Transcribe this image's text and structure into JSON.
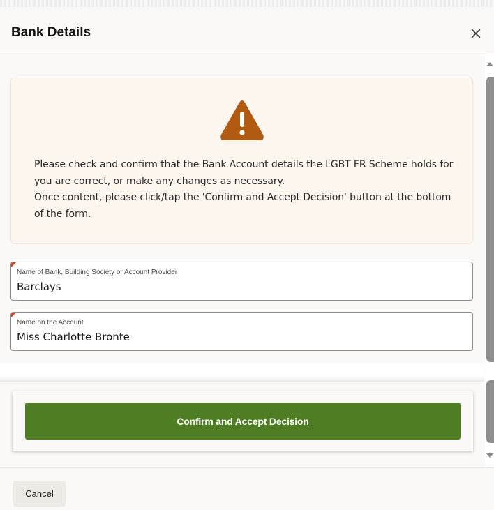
{
  "dialog": {
    "title": "Bank Details",
    "close_icon": "close-icon"
  },
  "warning": {
    "icon": "warning-triangle-icon",
    "icon_color": "#b05a12",
    "line1": "Please check and confirm that the Bank Account details the LGBT FR Scheme holds for you are correct, or make any changes as necessary.",
    "line2": "Once content, please click/tap the 'Confirm and Accept Decision' button at the bottom of the form."
  },
  "fields": {
    "bank_name": {
      "label": "Name of Bank, Building Society or Account Provider",
      "value": "Barclays"
    },
    "account_name": {
      "label": "Name on the Account",
      "value": "Miss Charlotte Bronte"
    }
  },
  "actions": {
    "confirm_label": "Confirm and Accept Decision",
    "confirm_color": "#4f7d23",
    "cancel_label": "Cancel"
  }
}
